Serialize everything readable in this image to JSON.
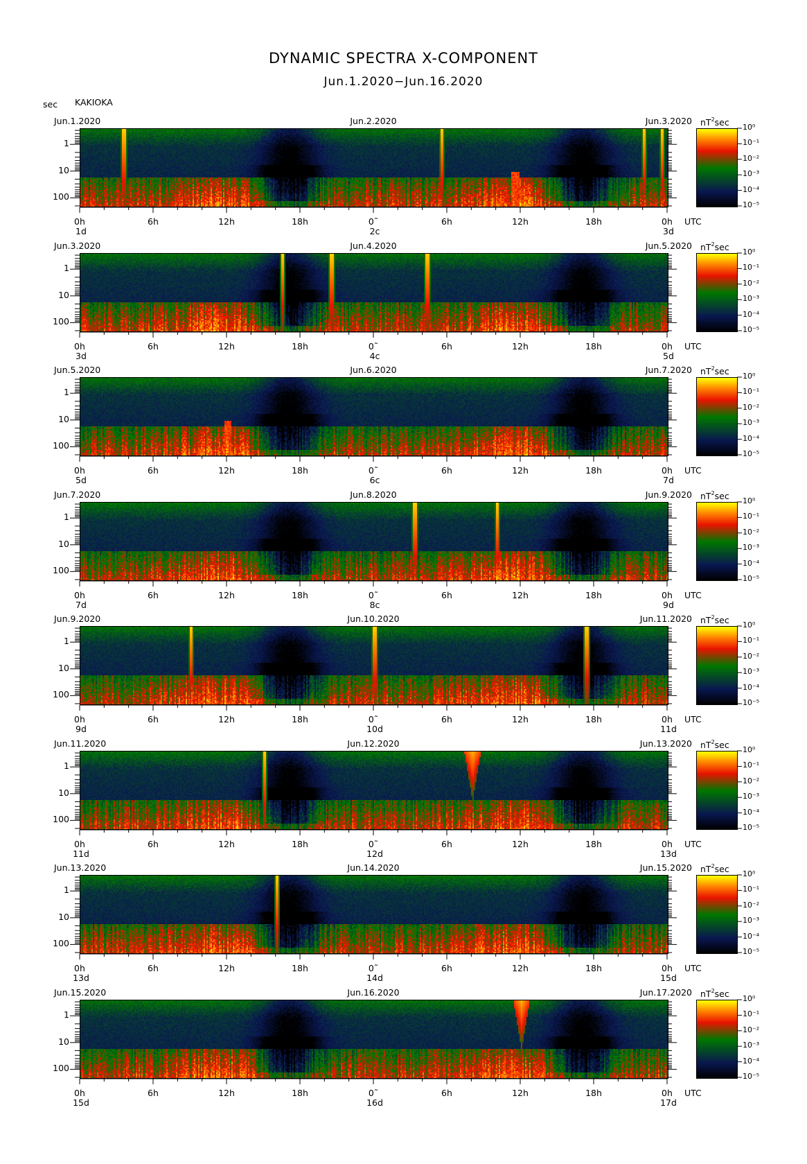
{
  "title": "DYNAMIC SPECTRA X-COMPONENT",
  "subtitle": "Jun.1.2020−Jun.16.2020",
  "y_unit": "sec",
  "station": "KAKIOKA",
  "units_label": "nT",
  "units_sup": "2",
  "units_suffix": "sec",
  "time_zone": "UTC",
  "chart_data": {
    "type": "heatmap",
    "title": "DYNAMIC SPECTRA X-COMPONENT",
    "subtitle": "Jun.1.2020−Jun.16.2020",
    "y_axis": {
      "label": "sec",
      "scale": "log",
      "ticks": [
        1,
        10,
        100
      ],
      "tick_labels": [
        "1",
        "10",
        "100"
      ],
      "range_sec": [
        0.25,
        200
      ]
    },
    "x_axis": {
      "label": "UTC",
      "tick_labels": [
        "0h",
        "6h",
        "12h",
        "18h",
        "0˜",
        "6h",
        "12h",
        "18h",
        "0h"
      ],
      "span_hours": 48
    },
    "colorbar": {
      "label": "nT²sec",
      "scale": "log",
      "min_exp": -5,
      "max_exp": 0,
      "labels": [
        "10⁰",
        "10⁻¹",
        "10⁻²",
        "10⁻³",
        "10⁻⁴",
        "10⁻⁵"
      ],
      "colors": [
        "#ffff00",
        "#ff8000",
        "#ff0000",
        "#008000",
        "#0a1850",
        "#000000"
      ]
    },
    "panels": [
      {
        "date_left": "Jun.1.2020",
        "date_mid": "Jun.2.2020",
        "date_right": "Jun.3.2020",
        "day_left": "1d",
        "day_mid": "2c",
        "day_right": "3d",
        "events": [
          {
            "hour": 3.5,
            "kind": "spike"
          },
          {
            "hour": 29.5,
            "kind": "spike"
          },
          {
            "hour": 35.5,
            "kind": "burst"
          },
          {
            "hour": 46.0,
            "kind": "spike"
          },
          {
            "hour": 47.5,
            "kind": "spike"
          }
        ]
      },
      {
        "date_left": "Jun.3.2020",
        "date_mid": "Jun.4.2020",
        "date_right": "Jun.5.2020",
        "day_left": "3d",
        "day_mid": "4c",
        "day_right": "5d",
        "events": [
          {
            "hour": 16.5,
            "kind": "spike"
          },
          {
            "hour": 20.5,
            "kind": "spike"
          },
          {
            "hour": 28.3,
            "kind": "spike"
          }
        ]
      },
      {
        "date_left": "Jun.5.2020",
        "date_mid": "Jun.6.2020",
        "date_right": "Jun.7.2020",
        "day_left": "5d",
        "day_mid": "6c",
        "day_right": "7d",
        "events": [
          {
            "hour": 12.0,
            "kind": "burst"
          }
        ]
      },
      {
        "date_left": "Jun.7.2020",
        "date_mid": "Jun.8.2020",
        "date_right": "Jun.9.2020",
        "day_left": "7d",
        "day_mid": "8c",
        "day_right": "9d",
        "events": [
          {
            "hour": 27.3,
            "kind": "spike"
          },
          {
            "hour": 34.0,
            "kind": "spike"
          }
        ]
      },
      {
        "date_left": "Jun.9.2020",
        "date_mid": "Jun.10.2020",
        "date_right": "Jun.11.2020",
        "day_left": "9d",
        "day_mid": "10d",
        "day_right": "11d",
        "events": [
          {
            "hour": 9.0,
            "kind": "spike"
          },
          {
            "hour": 24.0,
            "kind": "spike"
          },
          {
            "hour": 41.3,
            "kind": "spike"
          }
        ]
      },
      {
        "date_left": "Jun.11.2020",
        "date_mid": "Jun.12.2020",
        "date_right": "Jun.13.2020",
        "day_left": "11d",
        "day_mid": "12d",
        "day_right": "13d",
        "events": [
          {
            "hour": 15.0,
            "kind": "spike"
          },
          {
            "hour": 32.0,
            "kind": "cone"
          }
        ]
      },
      {
        "date_left": "Jun.13.2020",
        "date_mid": "Jun.14.2020",
        "date_right": "Jun.15.2020",
        "day_left": "13d",
        "day_mid": "14d",
        "day_right": "15d",
        "events": [
          {
            "hour": 16.0,
            "kind": "spike"
          }
        ]
      },
      {
        "date_left": "Jun.15.2020",
        "date_mid": "Jun.16.2020",
        "date_right": "Jun.17.2020",
        "day_left": "15d",
        "day_mid": "16d",
        "day_right": "17d",
        "events": [
          {
            "hour": 36.0,
            "kind": "cone"
          }
        ]
      }
    ]
  }
}
